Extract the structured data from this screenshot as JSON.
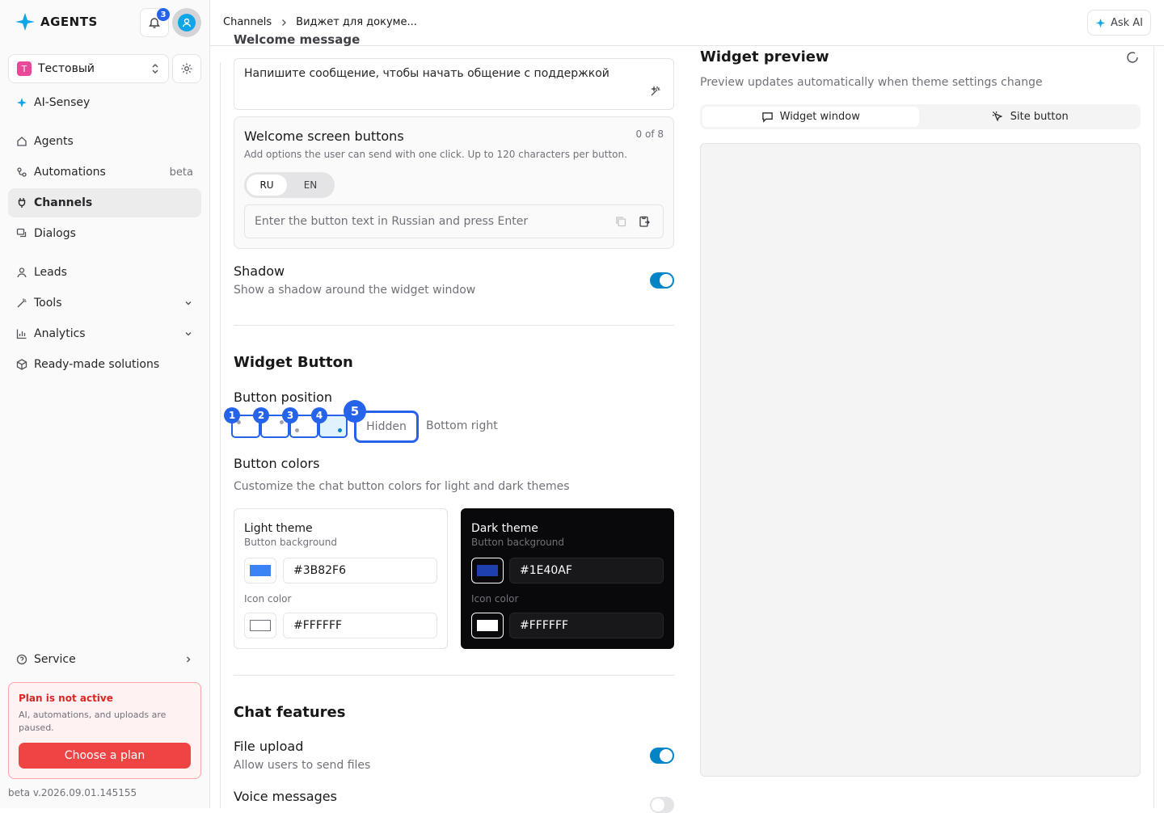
{
  "app": {
    "logo_text": "AGENTS",
    "notifications_count": "3"
  },
  "workspace": {
    "initial": "T",
    "name": "Тестовый"
  },
  "sidebar": {
    "featured": "AI-Sensey",
    "items": [
      {
        "label": "Agents"
      },
      {
        "label": "Automations",
        "tag": "beta"
      },
      {
        "label": "Channels"
      },
      {
        "label": "Dialogs"
      },
      {
        "label": "Leads"
      },
      {
        "label": "Tools"
      },
      {
        "label": "Analytics"
      },
      {
        "label": "Ready-made solutions"
      }
    ],
    "service": "Service"
  },
  "plan": {
    "title": "Plan is not active",
    "text": "AI, automations, and uploads are paused.",
    "button": "Choose a plan"
  },
  "version": "beta v.2026.09.01.145155",
  "header": {
    "breadcrumb": [
      "Channels",
      "Виджет для докуме..."
    ],
    "ask_ai": "Ask AI"
  },
  "settings": {
    "welcome_title_cut": "Welcome message",
    "welcome_text": "Напишите сообщение, чтобы начать общение с поддержкой",
    "welcome_buttons": {
      "title": "Welcome screen buttons",
      "count": "0 of 8",
      "desc": "Add options the user can send with one click. Up to 120 characters per button.",
      "langs": [
        "RU",
        "EN"
      ],
      "placeholder": "Enter the button text in Russian and press Enter"
    },
    "shadow": {
      "title": "Shadow",
      "desc": "Show a shadow around the widget window",
      "enabled": true
    },
    "widget_button": {
      "title": "Widget Button",
      "position_label": "Button position",
      "markers": [
        "1",
        "2",
        "3",
        "4",
        "5"
      ],
      "hidden_label": "Hidden",
      "position_value": "Bottom right"
    },
    "colors": {
      "title": "Button colors",
      "desc": "Customize the chat button colors for light and dark themes",
      "light": {
        "title": "Light theme",
        "bg_label": "Button background",
        "bg": "#3B82F6",
        "icon_label": "Icon color",
        "icon": "#FFFFFF"
      },
      "dark": {
        "title": "Dark theme",
        "bg_label": "Button background",
        "bg": "#1E40AF",
        "icon_label": "Icon color",
        "icon": "#FFFFFF"
      }
    },
    "chat_features": {
      "title": "Chat features",
      "file_upload": {
        "title": "File upload",
        "desc": "Allow users to send files",
        "enabled": true
      },
      "voice": {
        "title": "Voice messages",
        "enabled": false
      }
    }
  },
  "preview": {
    "title": "Widget preview",
    "desc": "Preview updates automatically when theme settings change",
    "tabs": [
      "Widget window",
      "Site button"
    ]
  },
  "colors": {
    "accent": "#2563eb",
    "toggle_on": "#0284c7",
    "danger": "#ef4444"
  }
}
